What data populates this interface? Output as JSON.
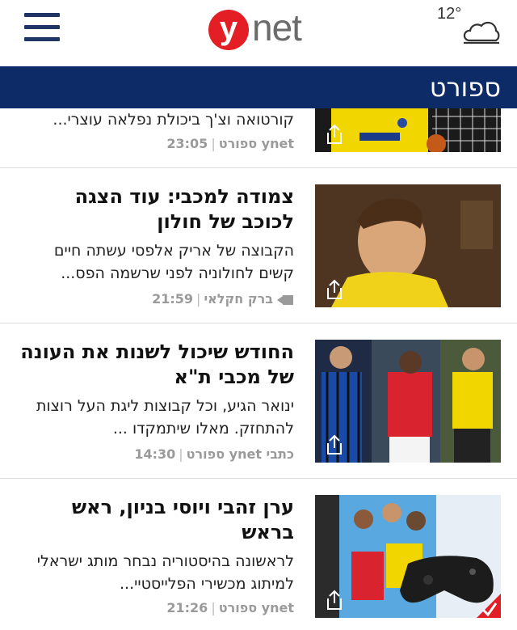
{
  "header": {
    "menu_icon": "hamburger-menu-icon",
    "logo_y": "y",
    "logo_net": "net",
    "weather_temp": "12°",
    "weather_icon": "cloud-icon",
    "accent_color": "#e31e24",
    "brand_color": "#0d2b67"
  },
  "section": {
    "title": "ספורט"
  },
  "articles": [
    {
      "headline": "",
      "summary": "קורטואה וצ'ך ביכולת נפלאה עוצרי...",
      "author": "ynet ספורט",
      "time": "23:05",
      "has_video": false,
      "share_icon": "share-icon"
    },
    {
      "headline": "צמודה למכבי: עוד הצגה לכוכב של חולון",
      "summary": "הקבוצה של אריק אלפסי עשתה חיים קשים לחולוניה לפני שרשמה הפס...",
      "author": "ברק חקלאי",
      "time": "21:59",
      "has_video": true,
      "share_icon": "share-icon"
    },
    {
      "headline": "החודש שיכול לשנות את העונה של מכבי ת\"א",
      "summary": "ינואר הגיע, וכל קבוצות ליגת העל רוצות להתחזק. מאלו שיתמקדו ...",
      "author": "כתבי ynet ספורט",
      "time": "14:30",
      "has_video": false,
      "share_icon": "share-icon"
    },
    {
      "headline": "ערן זהבי ויוסי בניון, ראש בראש",
      "summary": "לראשונה בהיסטוריה נבחר מותג ישראלי למיתוג מכשירי הפלייסטיי...",
      "author": "ynet ספורט",
      "time": "21:26",
      "has_video": false,
      "share_icon": "share-icon"
    }
  ]
}
